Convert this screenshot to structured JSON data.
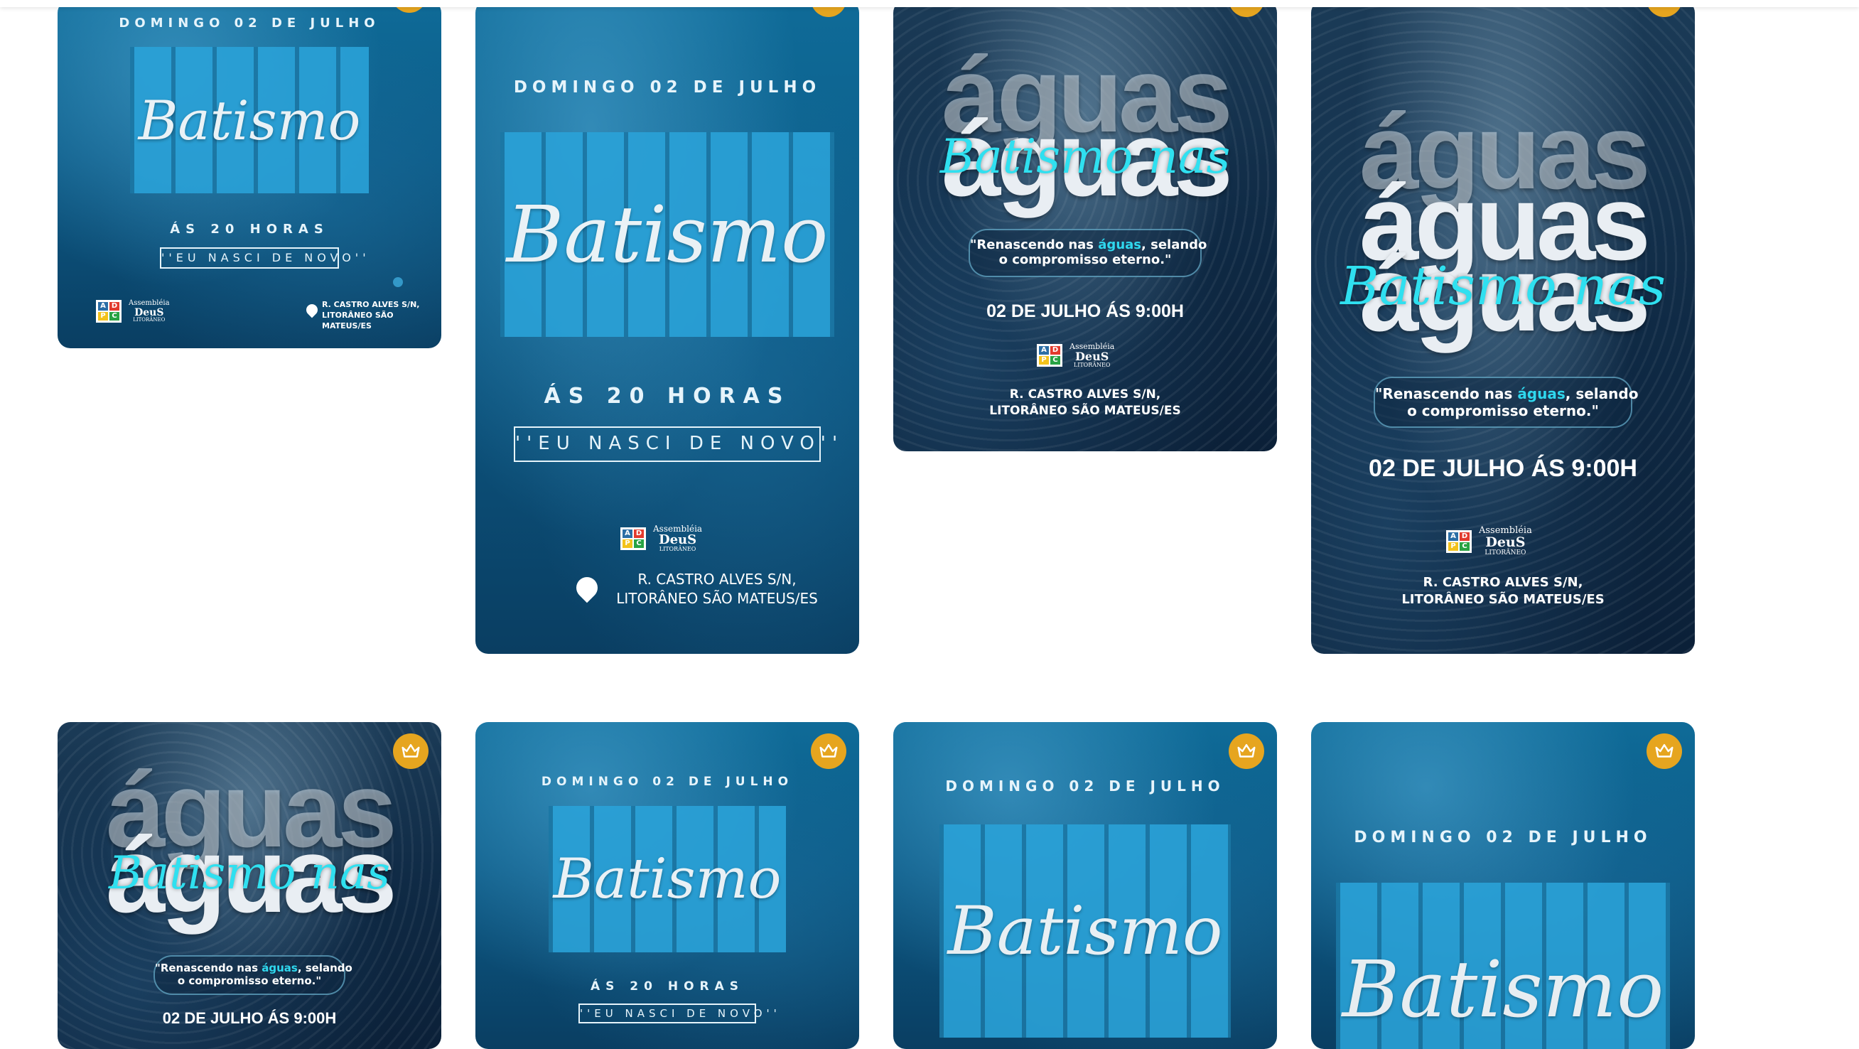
{
  "colors": {
    "premium_badge": "#e6a51f",
    "script_accent": "#2fe0f0",
    "card_blue": "#0f6b98",
    "card_dark": "#0f2a45"
  },
  "icons": [
    "crown-icon",
    "location-pin-icon"
  ],
  "templates": {
    "batismo": {
      "date": "DOMINGO 02 DE JULHO",
      "block_word": "BATISMO",
      "script": "Batismo",
      "hours": "ÁS 20 HORAS",
      "slogan": "''EU NASCI DE NOVO''",
      "address_line1": "R. CASTRO ALVES S/N,",
      "address_line2": "LITORÂNEO SÃO MATEUS/ES",
      "logo_line1": "Assembléia",
      "logo_line2": "DeuS",
      "logo_line3": "LITORÂNEO"
    },
    "aguas": {
      "word": "águas",
      "script": "Batismo nas",
      "quote_part1": "\"Renascendo nas ",
      "quote_highlight": "águas",
      "quote_part2": ", selando",
      "quote_line2": "o compromisso eterno.\"",
      "when": "02 DE JULHO ÁS 9:00H",
      "address_line1": "R. CASTRO ALVES S/N,",
      "address_line2": "LITORÂNEO SÃO MATEUS/ES",
      "logo_mark": [
        "A",
        "D",
        "P",
        "C"
      ]
    }
  }
}
